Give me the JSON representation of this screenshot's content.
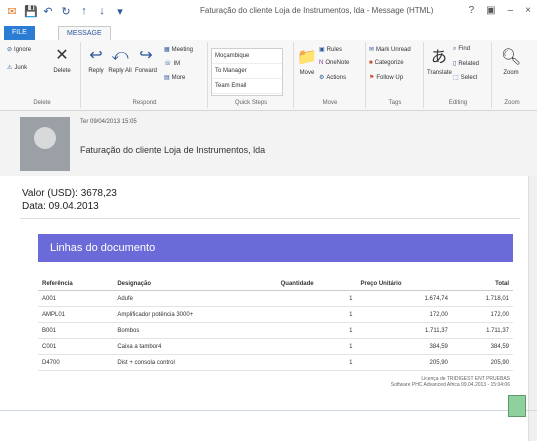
{
  "titlebar": {
    "title": "Faturação do cliente Loja de Instrumentos, lda - Message (HTML)",
    "help": "?",
    "restore": "▣",
    "minimize": "–",
    "close": "×"
  },
  "tabs": [
    {
      "label": "FILE"
    },
    {
      "label": "MESSAGE"
    }
  ],
  "ribbon": {
    "delete_group": {
      "label": "Delete",
      "ignore": "Ignore",
      "junk": "Junk",
      "delete": "Delete"
    },
    "respond_group": {
      "label": "Respond",
      "reply": "Reply",
      "reply_all": "Reply All",
      "forward": "Forward",
      "meeting": "Meeting",
      "im": "IM",
      "more": "More"
    },
    "quicksteps_group": {
      "label": "Quick Steps",
      "items": [
        "Moçambique",
        "To Manager",
        "Team Email"
      ]
    },
    "move_group": {
      "label": "Move",
      "move": "Move",
      "rules": "Rules",
      "onenote": "OneNote",
      "actions": "Actions"
    },
    "tags_group": {
      "label": "Tags",
      "unread": "Mark Unread",
      "categorize": "Categorize",
      "follow": "Follow Up"
    },
    "editing_group": {
      "label": "Editing",
      "translate": "Translate",
      "find": "Find",
      "related": "Related",
      "select": "Select"
    },
    "zoom_group": {
      "label": "Zoom",
      "zoom": "Zoom"
    }
  },
  "message": {
    "date": "Ter 09/04/2013 15:05",
    "subject": "Faturação do cliente Loja de Instrumentos, lda"
  },
  "body": {
    "valor": "Valor (USD): 3678,23",
    "data": "Data: 09.04.2013",
    "section_title": "Linhas do documento",
    "columns": [
      "Referência",
      "Designação",
      "Quantidade",
      "Preço Unitário",
      "Total"
    ],
    "rows": [
      {
        "ref": "A001",
        "design": "Adufe",
        "qty": "1",
        "price": "1.674,74",
        "total": "1.718,01"
      },
      {
        "ref": "AMPL01",
        "design": "Amplificador potência 3000+",
        "qty": "1",
        "price": "172,00",
        "total": "172,00"
      },
      {
        "ref": "B001",
        "design": "Bombos",
        "qty": "1",
        "price": "1.711,37",
        "total": "1.711,37"
      },
      {
        "ref": "C001",
        "design": "Caixa a tambor4",
        "qty": "1",
        "price": "384,59",
        "total": "384,59"
      },
      {
        "ref": "D4700",
        "design": "Dist + consola control",
        "qty": "1",
        "price": "205,90",
        "total": "205,90"
      }
    ],
    "footer1": "Licença de TRIDIGEST ENT PRUEBAS",
    "footer2": "Software PHC Advanced Africa 09.04.2013 - 15:04:06"
  }
}
